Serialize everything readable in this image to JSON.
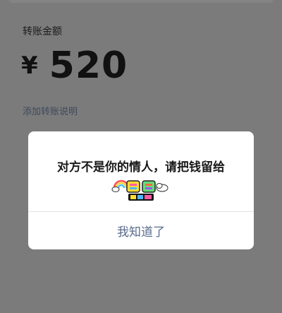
{
  "transfer": {
    "amount_label": "转账金额",
    "currency_symbol": "¥",
    "amount": "520",
    "note_link": "添加转账说明"
  },
  "dialog": {
    "message": "对方不是你的情人，请把钱留给",
    "sticker_icon": "rainbow-sticker-icon",
    "confirm_label": "我知道了"
  },
  "colors": {
    "overlay_bg": "#7b7b7b",
    "dialog_bg": "#ffffff",
    "confirm_text": "#5a6b8c"
  }
}
